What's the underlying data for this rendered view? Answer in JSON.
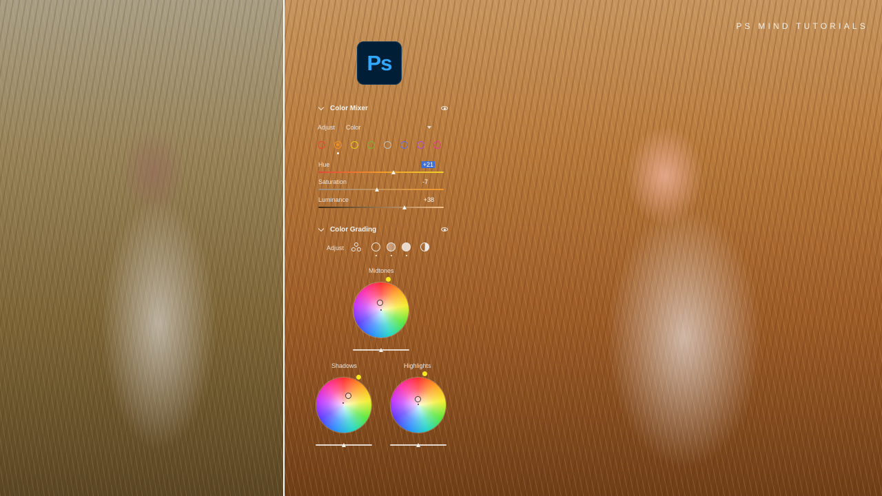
{
  "brand": {
    "watermark": "PS MIND TUTORIALS"
  },
  "app": {
    "logo_text": "Ps",
    "brand_color": "#31a8ff",
    "logo_bg": "#001e36"
  },
  "color_mixer": {
    "title": "Color Mixer",
    "adjust_label": "Adjust",
    "adjust_value": "Color",
    "swatches": [
      {
        "name": "red",
        "color": "#e8452e",
        "selected": false
      },
      {
        "name": "orange",
        "color": "#f5921f",
        "selected": true
      },
      {
        "name": "yellow",
        "color": "#e8d21c",
        "selected": false
      },
      {
        "name": "green",
        "color": "#79b82e",
        "selected": false
      },
      {
        "name": "aqua",
        "color": "#b7c6c8",
        "selected": false
      },
      {
        "name": "blue",
        "color": "#5a6ee8",
        "selected": false
      },
      {
        "name": "purple",
        "color": "#b04be0",
        "selected": false
      },
      {
        "name": "magenta",
        "color": "#e8339c",
        "selected": false
      }
    ],
    "sliders": [
      {
        "label": "Hue",
        "value": "+21",
        "level": 0.6,
        "active": true
      },
      {
        "label": "Saturation",
        "value": "-7",
        "level": 0.47,
        "active": false
      },
      {
        "label": "Luminance",
        "value": "+38",
        "level": 0.69,
        "active": false
      }
    ]
  },
  "color_grading": {
    "title": "Color Grading",
    "adjust_label": "Adjust",
    "wheels": [
      {
        "label": "Midtones",
        "balance_level": 0.5
      },
      {
        "label": "Shadows",
        "balance_level": 0.5
      },
      {
        "label": "Highlights",
        "balance_level": 0.5
      }
    ]
  }
}
